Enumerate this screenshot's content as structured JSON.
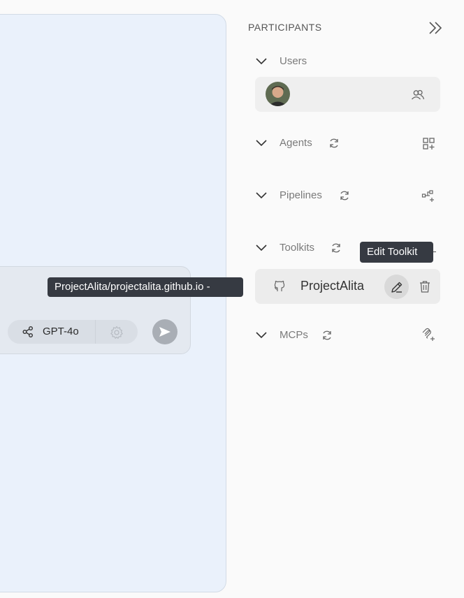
{
  "chat": {
    "model_label": "GPT-4o",
    "path_tooltip": "ProjectAlita/projectalita.github.io -"
  },
  "participants": {
    "title": "PARTICIPANTS",
    "sections": {
      "users": {
        "label": "Users"
      },
      "agents": {
        "label": "Agents"
      },
      "pipelines": {
        "label": "Pipelines"
      },
      "toolkits": {
        "label": "Toolkits",
        "item_name": "ProjectAlita",
        "edit_tooltip": "Edit Toolkit"
      },
      "mcps": {
        "label": "MCPs"
      }
    }
  },
  "icons": {
    "collapse": "double-chevron-right-icon",
    "chevron": "chevron-down-icon",
    "refresh": "refresh-icon",
    "users_group": "users-group-icon",
    "add_agent": "grid-plus-icon",
    "add_pipeline": "flow-plus-icon",
    "add_mcp": "mcp-plus-icon",
    "github": "github-icon",
    "edit": "pencil-icon",
    "delete": "trash-icon",
    "share": "share-icon",
    "settings": "gear-icon",
    "send": "send-icon"
  },
  "colors": {
    "chat_bg": "#eaf1fb",
    "tooltip_bg": "#363a42",
    "card_bg": "#efefef"
  }
}
